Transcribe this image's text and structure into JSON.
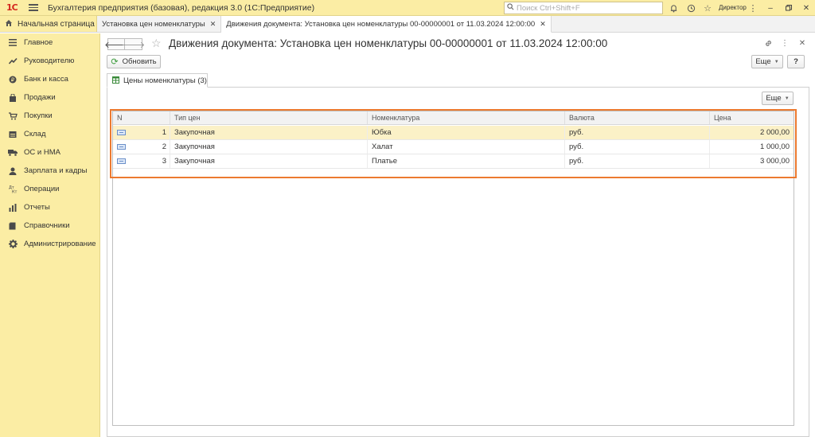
{
  "titlebar": {
    "logo": "1С",
    "app_title": "Бухгалтерия предприятия (базовая), редакция 3.0  (1С:Предприятие)",
    "search_placeholder": "Поиск Ctrl+Shift+F",
    "user": "Директор"
  },
  "tabs": {
    "home": "Начальная страница",
    "items": [
      {
        "label": "Установка цен номенклатуры"
      },
      {
        "label": "Движения документа: Установка цен номенклатуры 00-00000001 от 11.03.2024 12:00:00"
      }
    ]
  },
  "sidebar": {
    "items": [
      {
        "label": "Главное",
        "icon": "menu-icon"
      },
      {
        "label": "Руководителю",
        "icon": "chart-up-icon"
      },
      {
        "label": "Банк и касса",
        "icon": "coin-icon"
      },
      {
        "label": "Продажи",
        "icon": "bag-icon"
      },
      {
        "label": "Покупки",
        "icon": "cart-icon"
      },
      {
        "label": "Склад",
        "icon": "warehouse-icon"
      },
      {
        "label": "ОС и НМА",
        "icon": "truck-icon"
      },
      {
        "label": "Зарплата и кадры",
        "icon": "person-icon"
      },
      {
        "label": "Операции",
        "icon": "dt-kt-icon"
      },
      {
        "label": "Отчеты",
        "icon": "bar-chart-icon"
      },
      {
        "label": "Справочники",
        "icon": "book-icon"
      },
      {
        "label": "Администрирование",
        "icon": "gear-icon"
      }
    ]
  },
  "document": {
    "title": "Движения документа: Установка цен номенклатуры 00-00000001 от 11.03.2024 12:00:00",
    "refresh_label": "Обновить",
    "more_label": "Еще",
    "help_label": "?",
    "inner_tab_label": "Цены номенклатуры (3)"
  },
  "table": {
    "columns": [
      "N",
      "Тип цен",
      "Номенклатура",
      "Валюта",
      "Цена"
    ],
    "rows": [
      {
        "n": "1",
        "type": "Закупочная",
        "item": "Юбка",
        "currency": "руб.",
        "price": "2 000,00"
      },
      {
        "n": "2",
        "type": "Закупочная",
        "item": "Халат",
        "currency": "руб.",
        "price": "1 000,00"
      },
      {
        "n": "3",
        "type": "Закупочная",
        "item": "Платье",
        "currency": "руб.",
        "price": "3 000,00"
      }
    ]
  },
  "colors": {
    "accent_yellow": "#fbeda4",
    "highlight_orange": "#ec7a30",
    "selected_row": "#fbf1c7"
  }
}
